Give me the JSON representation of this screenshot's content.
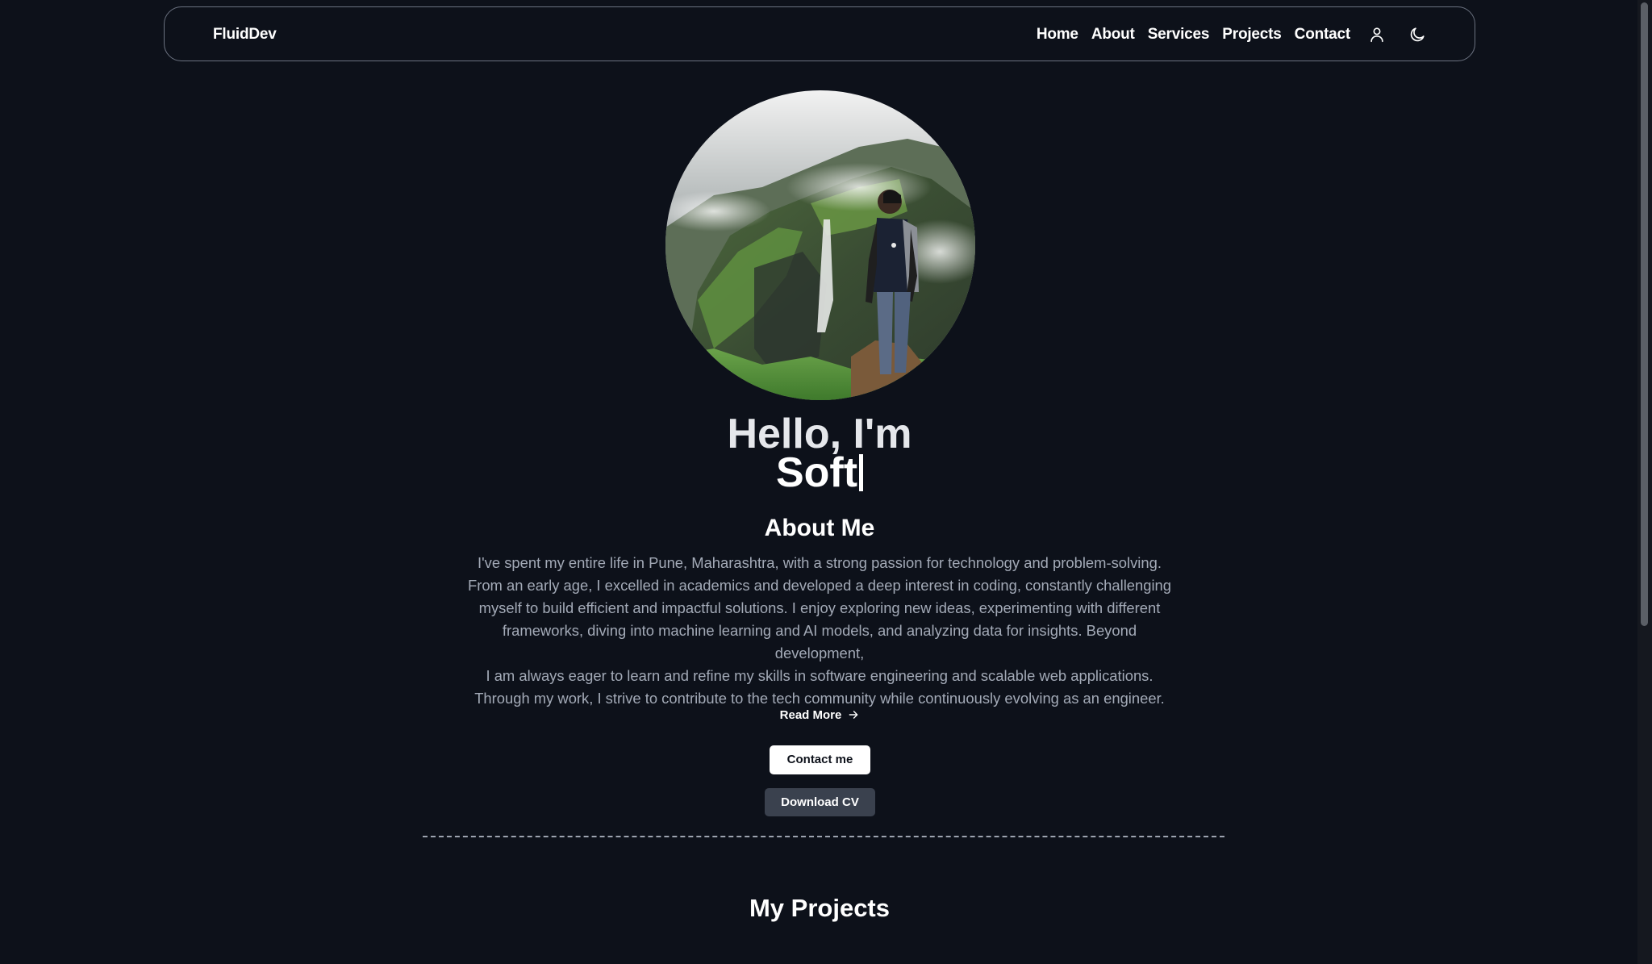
{
  "nav": {
    "brand": "FluidDev",
    "links": [
      "Home",
      "About",
      "Services",
      "Projects",
      "Contact"
    ],
    "icons": [
      "user-icon",
      "moon-icon"
    ]
  },
  "hero": {
    "greeting": "Hello, I'm",
    "typed_text": "Soft",
    "avatar_description": "profile-photo"
  },
  "about": {
    "heading": "About Me",
    "lines": [
      "I've spent my entire life in Pune, Maharashtra, with a strong passion for technology and problem-solving.",
      "From an early age, I excelled in academics and developed a deep interest in coding, constantly challenging",
      "myself to build efficient and impactful solutions. I enjoy exploring new ideas, experimenting with different",
      "frameworks, diving into machine learning and AI models, and analyzing data for insights. Beyond development,",
      "I am always eager to learn and refine my skills in software engineering and scalable web applications.",
      "Through my work, I strive to contribute to the tech community while continuously evolving as an engineer."
    ],
    "read_more": "Read More"
  },
  "buttons": {
    "contact": "Contact me",
    "download_cv": "Download CV"
  },
  "projects": {
    "heading": "My Projects"
  },
  "colors": {
    "background": "#0d111a",
    "text": "#ffffff",
    "muted": "#a3aab7",
    "secondary_button": "#3a414e"
  }
}
